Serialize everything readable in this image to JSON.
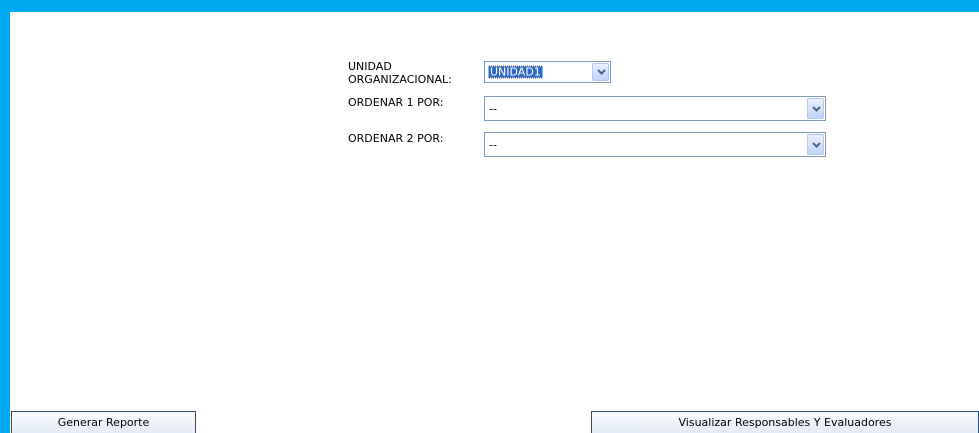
{
  "form": {
    "unidad_label_line1": "UNIDAD",
    "unidad_label_line2": "ORGANIZACIONAL:",
    "unidad_value": "UNIDAD1",
    "ordenar1_label": "ORDENAR 1 POR:",
    "ordenar1_value": "--",
    "ordenar2_label": "ORDENAR 2 POR:",
    "ordenar2_value": "--"
  },
  "buttons": {
    "generar_label": "Generar Reporte",
    "visualizar_label": "Visualizar Responsables Y Evaluadores"
  },
  "colors": {
    "frame": "#00a8f0",
    "selection": "#316ac5"
  },
  "icons": {
    "dropdown": "chevron-down-icon"
  }
}
